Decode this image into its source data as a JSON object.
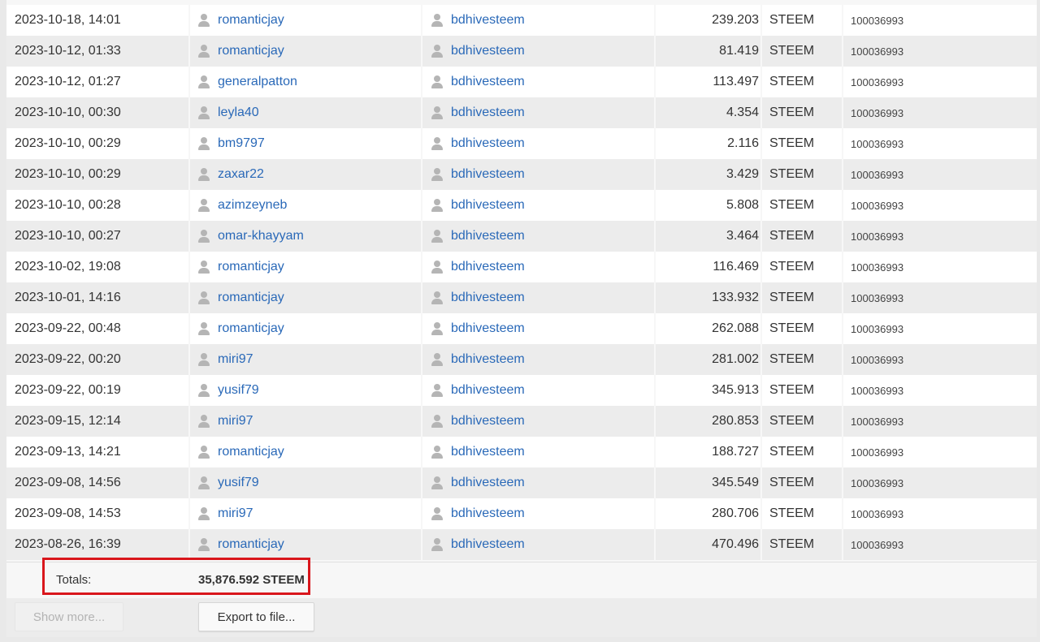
{
  "transfers": [
    {
      "date": "2023-10-18, 14:01",
      "from": "romanticjay",
      "to": "bdhivesteem",
      "amount": "239.203",
      "unit": "STEEM",
      "memo": "100036993"
    },
    {
      "date": "2023-10-12, 01:33",
      "from": "romanticjay",
      "to": "bdhivesteem",
      "amount": "81.419",
      "unit": "STEEM",
      "memo": "100036993"
    },
    {
      "date": "2023-10-12, 01:27",
      "from": "generalpatton",
      "to": "bdhivesteem",
      "amount": "113.497",
      "unit": "STEEM",
      "memo": "100036993"
    },
    {
      "date": "2023-10-10, 00:30",
      "from": "leyla40",
      "to": "bdhivesteem",
      "amount": "4.354",
      "unit": "STEEM",
      "memo": "100036993"
    },
    {
      "date": "2023-10-10, 00:29",
      "from": "bm9797",
      "to": "bdhivesteem",
      "amount": "2.116",
      "unit": "STEEM",
      "memo": "100036993"
    },
    {
      "date": "2023-10-10, 00:29",
      "from": "zaxar22",
      "to": "bdhivesteem",
      "amount": "3.429",
      "unit": "STEEM",
      "memo": "100036993"
    },
    {
      "date": "2023-10-10, 00:28",
      "from": "azimzeyneb",
      "to": "bdhivesteem",
      "amount": "5.808",
      "unit": "STEEM",
      "memo": "100036993"
    },
    {
      "date": "2023-10-10, 00:27",
      "from": "omar-khayyam",
      "to": "bdhivesteem",
      "amount": "3.464",
      "unit": "STEEM",
      "memo": "100036993"
    },
    {
      "date": "2023-10-02, 19:08",
      "from": "romanticjay",
      "to": "bdhivesteem",
      "amount": "116.469",
      "unit": "STEEM",
      "memo": "100036993"
    },
    {
      "date": "2023-10-01, 14:16",
      "from": "romanticjay",
      "to": "bdhivesteem",
      "amount": "133.932",
      "unit": "STEEM",
      "memo": "100036993"
    },
    {
      "date": "2023-09-22, 00:48",
      "from": "romanticjay",
      "to": "bdhivesteem",
      "amount": "262.088",
      "unit": "STEEM",
      "memo": "100036993"
    },
    {
      "date": "2023-09-22, 00:20",
      "from": "miri97",
      "to": "bdhivesteem",
      "amount": "281.002",
      "unit": "STEEM",
      "memo": "100036993"
    },
    {
      "date": "2023-09-22, 00:19",
      "from": "yusif79",
      "to": "bdhivesteem",
      "amount": "345.913",
      "unit": "STEEM",
      "memo": "100036993"
    },
    {
      "date": "2023-09-15, 12:14",
      "from": "miri97",
      "to": "bdhivesteem",
      "amount": "280.853",
      "unit": "STEEM",
      "memo": "100036993"
    },
    {
      "date": "2023-09-13, 14:21",
      "from": "romanticjay",
      "to": "bdhivesteem",
      "amount": "188.727",
      "unit": "STEEM",
      "memo": "100036993"
    },
    {
      "date": "2023-09-08, 14:56",
      "from": "yusif79",
      "to": "bdhivesteem",
      "amount": "345.549",
      "unit": "STEEM",
      "memo": "100036993"
    },
    {
      "date": "2023-09-08, 14:53",
      "from": "miri97",
      "to": "bdhivesteem",
      "amount": "280.706",
      "unit": "STEEM",
      "memo": "100036993"
    },
    {
      "date": "2023-08-26, 16:39",
      "from": "romanticjay",
      "to": "bdhivesteem",
      "amount": "470.496",
      "unit": "STEEM",
      "memo": "100036993"
    }
  ],
  "totals": {
    "label": "Totals:",
    "value": "35,876.592 STEEM"
  },
  "buttons": {
    "show_more": "Show more...",
    "export": "Export to file..."
  },
  "colors": {
    "link": "#2a69b8",
    "highlight": "#d9161c",
    "row_alt": "#ececec"
  },
  "icons": {
    "user": "user-icon"
  }
}
